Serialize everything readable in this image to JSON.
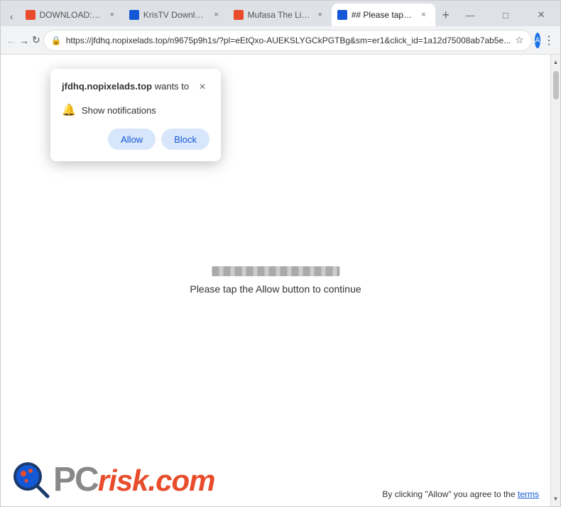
{
  "browser": {
    "tabs": [
      {
        "id": "tab1",
        "favicon_color": "#e84c2b",
        "title": "DOWNLOAD: Mufas...",
        "active": false
      },
      {
        "id": "tab2",
        "favicon_color": "#1558d6",
        "title": "KrisTV Download Pa...",
        "active": false
      },
      {
        "id": "tab3",
        "favicon_color": "#e84c2b",
        "title": "Mufasa The Lion Kin...",
        "active": false
      },
      {
        "id": "tab4",
        "favicon_color": "#1558d6",
        "title": "## Please tap the All...",
        "active": true
      }
    ],
    "url": "https://jfdhq.nopixelads.top/n9675p9h1s/?pl=eEtQxo-AUEKSLYGCkPGTBg&sm=er1&click_id=1a12d75008ab7ab5e...",
    "profile_letter": "A"
  },
  "popup": {
    "title_bold": "jfdhq.nopixelads.top",
    "title_suffix": " wants to",
    "close_label": "×",
    "notification_label": "Show notifications",
    "allow_label": "Allow",
    "block_label": "Block"
  },
  "page": {
    "progress_label": "",
    "instruction_text": "Please tap the Allow button to continue"
  },
  "footer": {
    "terms_prefix": "By clicking \"Allow\" you agree to the ",
    "terms_link": "terms",
    "logo_text_pc": "PC",
    "logo_text_risk": "risk",
    "logo_text_dot_com": ".com"
  }
}
